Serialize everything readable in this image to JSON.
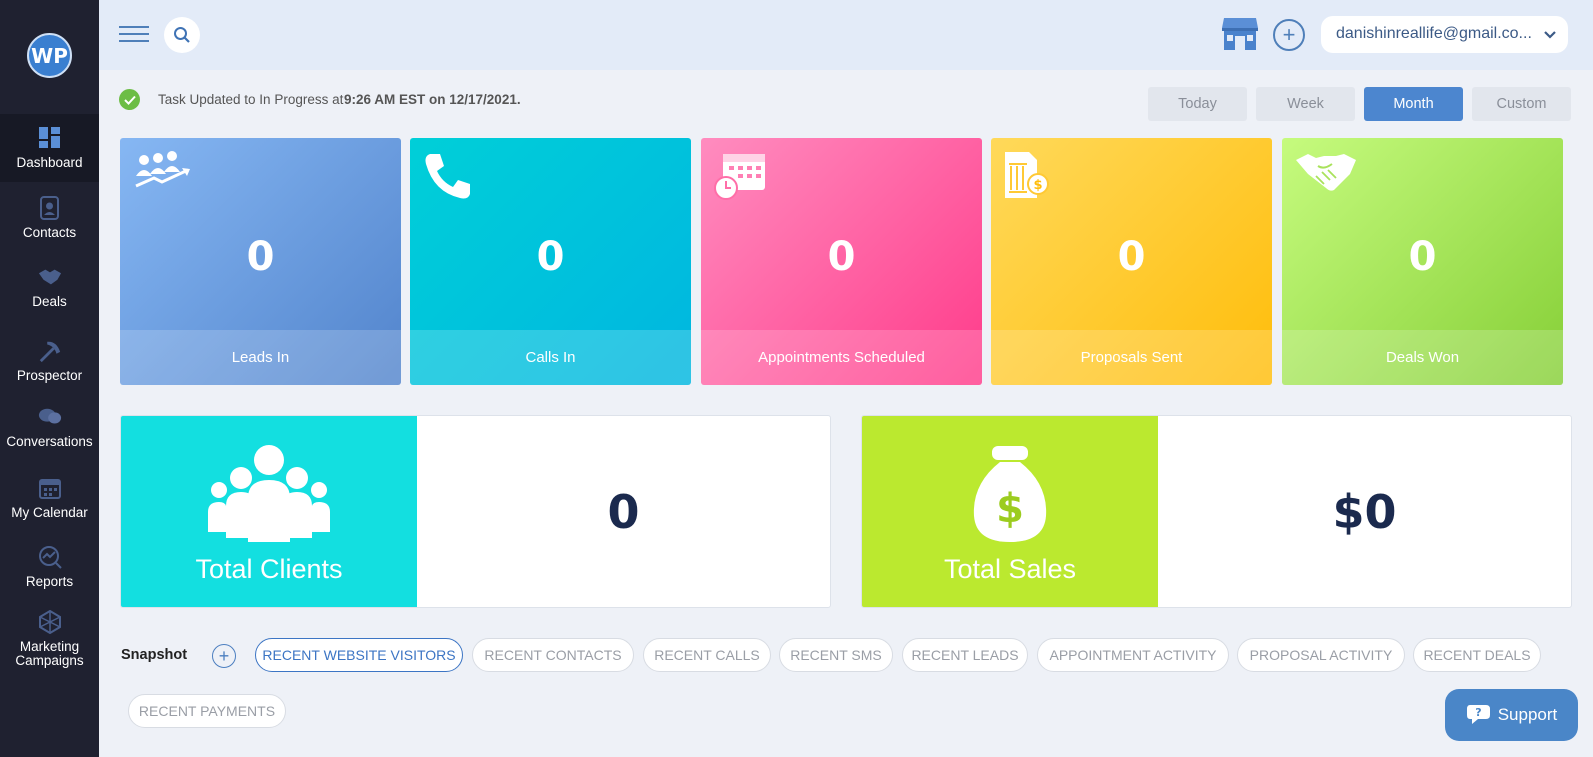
{
  "logo": {
    "text": "WP"
  },
  "sidebar": {
    "items": [
      {
        "label": "Dashboard",
        "icon": "dashboard-icon"
      },
      {
        "label": "Contacts",
        "icon": "contacts-icon"
      },
      {
        "label": "Deals",
        "icon": "handshake-icon"
      },
      {
        "label": "Prospector",
        "icon": "pickaxe-icon"
      },
      {
        "label": "Conversations",
        "icon": "chat-icon"
      },
      {
        "label": "My Calendar",
        "icon": "calendar-icon"
      },
      {
        "label": "Reports",
        "icon": "reports-icon"
      },
      {
        "label": "Marketing Campaigns",
        "icon": "campaigns-icon"
      }
    ]
  },
  "header": {
    "account_email": "danishinreallife@gmail.co..."
  },
  "status": {
    "text": "Task Updated to In Progress at",
    "time": "9:26 AM EST on 12/17/2021."
  },
  "range": {
    "today": "Today",
    "week": "Week",
    "month": "Month",
    "custom": "Custom",
    "selected": "Month"
  },
  "cards": [
    {
      "label": "Leads In",
      "value": "0",
      "icon": "leads-icon"
    },
    {
      "label": "Calls In",
      "value": "0",
      "icon": "phone-icon"
    },
    {
      "label": "Appointments Scheduled",
      "value": "0",
      "icon": "calendar-clock-icon"
    },
    {
      "label": "Proposals Sent",
      "value": "0",
      "icon": "proposal-icon"
    },
    {
      "label": "Deals Won",
      "value": "0",
      "icon": "handshake-icon"
    }
  ],
  "panels": {
    "clients": {
      "title": "Total Clients",
      "value": "0"
    },
    "sales": {
      "title": "Total Sales",
      "value": "$0"
    }
  },
  "snapshot": {
    "label": "Snapshot",
    "tabs": [
      "RECENT WEBSITE VISITORS",
      "RECENT CONTACTS",
      "RECENT CALLS",
      "RECENT SMS",
      "RECENT LEADS",
      "APPOINTMENT ACTIVITY",
      "PROPOSAL ACTIVITY",
      "RECENT DEALS",
      "RECENT PAYMENTS"
    ]
  },
  "support": {
    "label": "Support"
  },
  "colors": {
    "sidebar": "#1f2130",
    "accent": "#4c86cf",
    "clients_panel": "#13dfe0",
    "sales_panel": "#bbe92f"
  }
}
